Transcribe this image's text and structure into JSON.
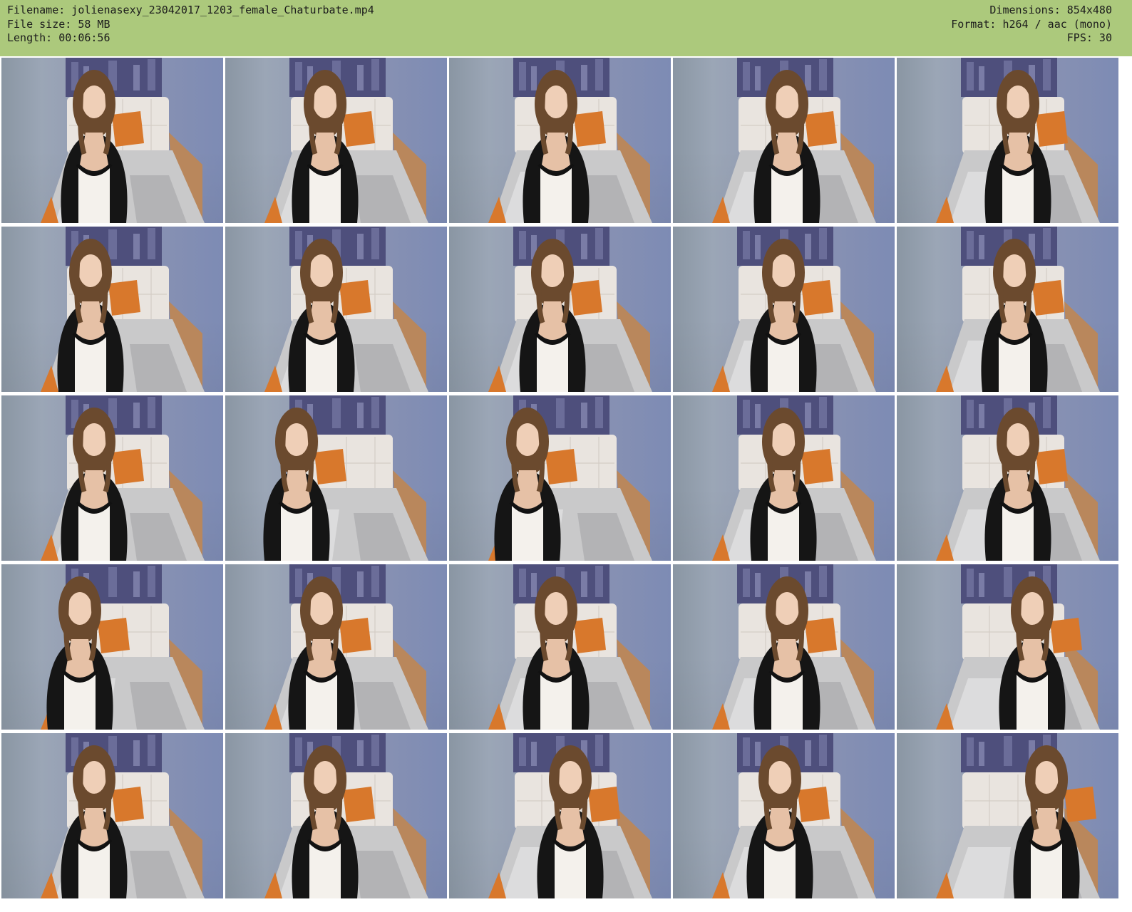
{
  "info": {
    "filename": "Filename: jolienasexy_23042017_1203_female_Chaturbate.mp4",
    "filesize": "File size: 58 MB",
    "length": "Length: 00:06:56",
    "dimensions": "Dimensions: 854x480",
    "format": "Format: h264 / aac (mono)",
    "fps": "FPS: 30"
  },
  "colors": {
    "header_bg": "#acc97c",
    "wall": "#8b93b2",
    "headboard": "#e9e4df",
    "pillow": "#d8782c",
    "bedding": "#c9c9ca",
    "cardigan": "#151515",
    "top": "#f4f1ec",
    "hair": "#6b4a2e"
  },
  "thumbnails": [
    {
      "icon": "video-frame-image"
    },
    {
      "icon": "video-frame-image"
    },
    {
      "icon": "video-frame-image"
    },
    {
      "icon": "video-frame-image"
    },
    {
      "icon": "video-frame-image"
    },
    {
      "icon": "video-frame-image"
    },
    {
      "icon": "video-frame-image"
    },
    {
      "icon": "video-frame-image"
    },
    {
      "icon": "video-frame-image"
    },
    {
      "icon": "video-frame-image"
    },
    {
      "icon": "video-frame-image"
    },
    {
      "icon": "video-frame-image"
    },
    {
      "icon": "video-frame-image"
    },
    {
      "icon": "video-frame-image"
    },
    {
      "icon": "video-frame-image"
    },
    {
      "icon": "video-frame-image"
    },
    {
      "icon": "video-frame-image"
    },
    {
      "icon": "video-frame-image"
    },
    {
      "icon": "video-frame-image"
    },
    {
      "icon": "video-frame-image"
    },
    {
      "icon": "video-frame-image"
    },
    {
      "icon": "video-frame-image"
    },
    {
      "icon": "video-frame-image"
    },
    {
      "icon": "video-frame-image"
    },
    {
      "icon": "video-frame-image"
    }
  ]
}
